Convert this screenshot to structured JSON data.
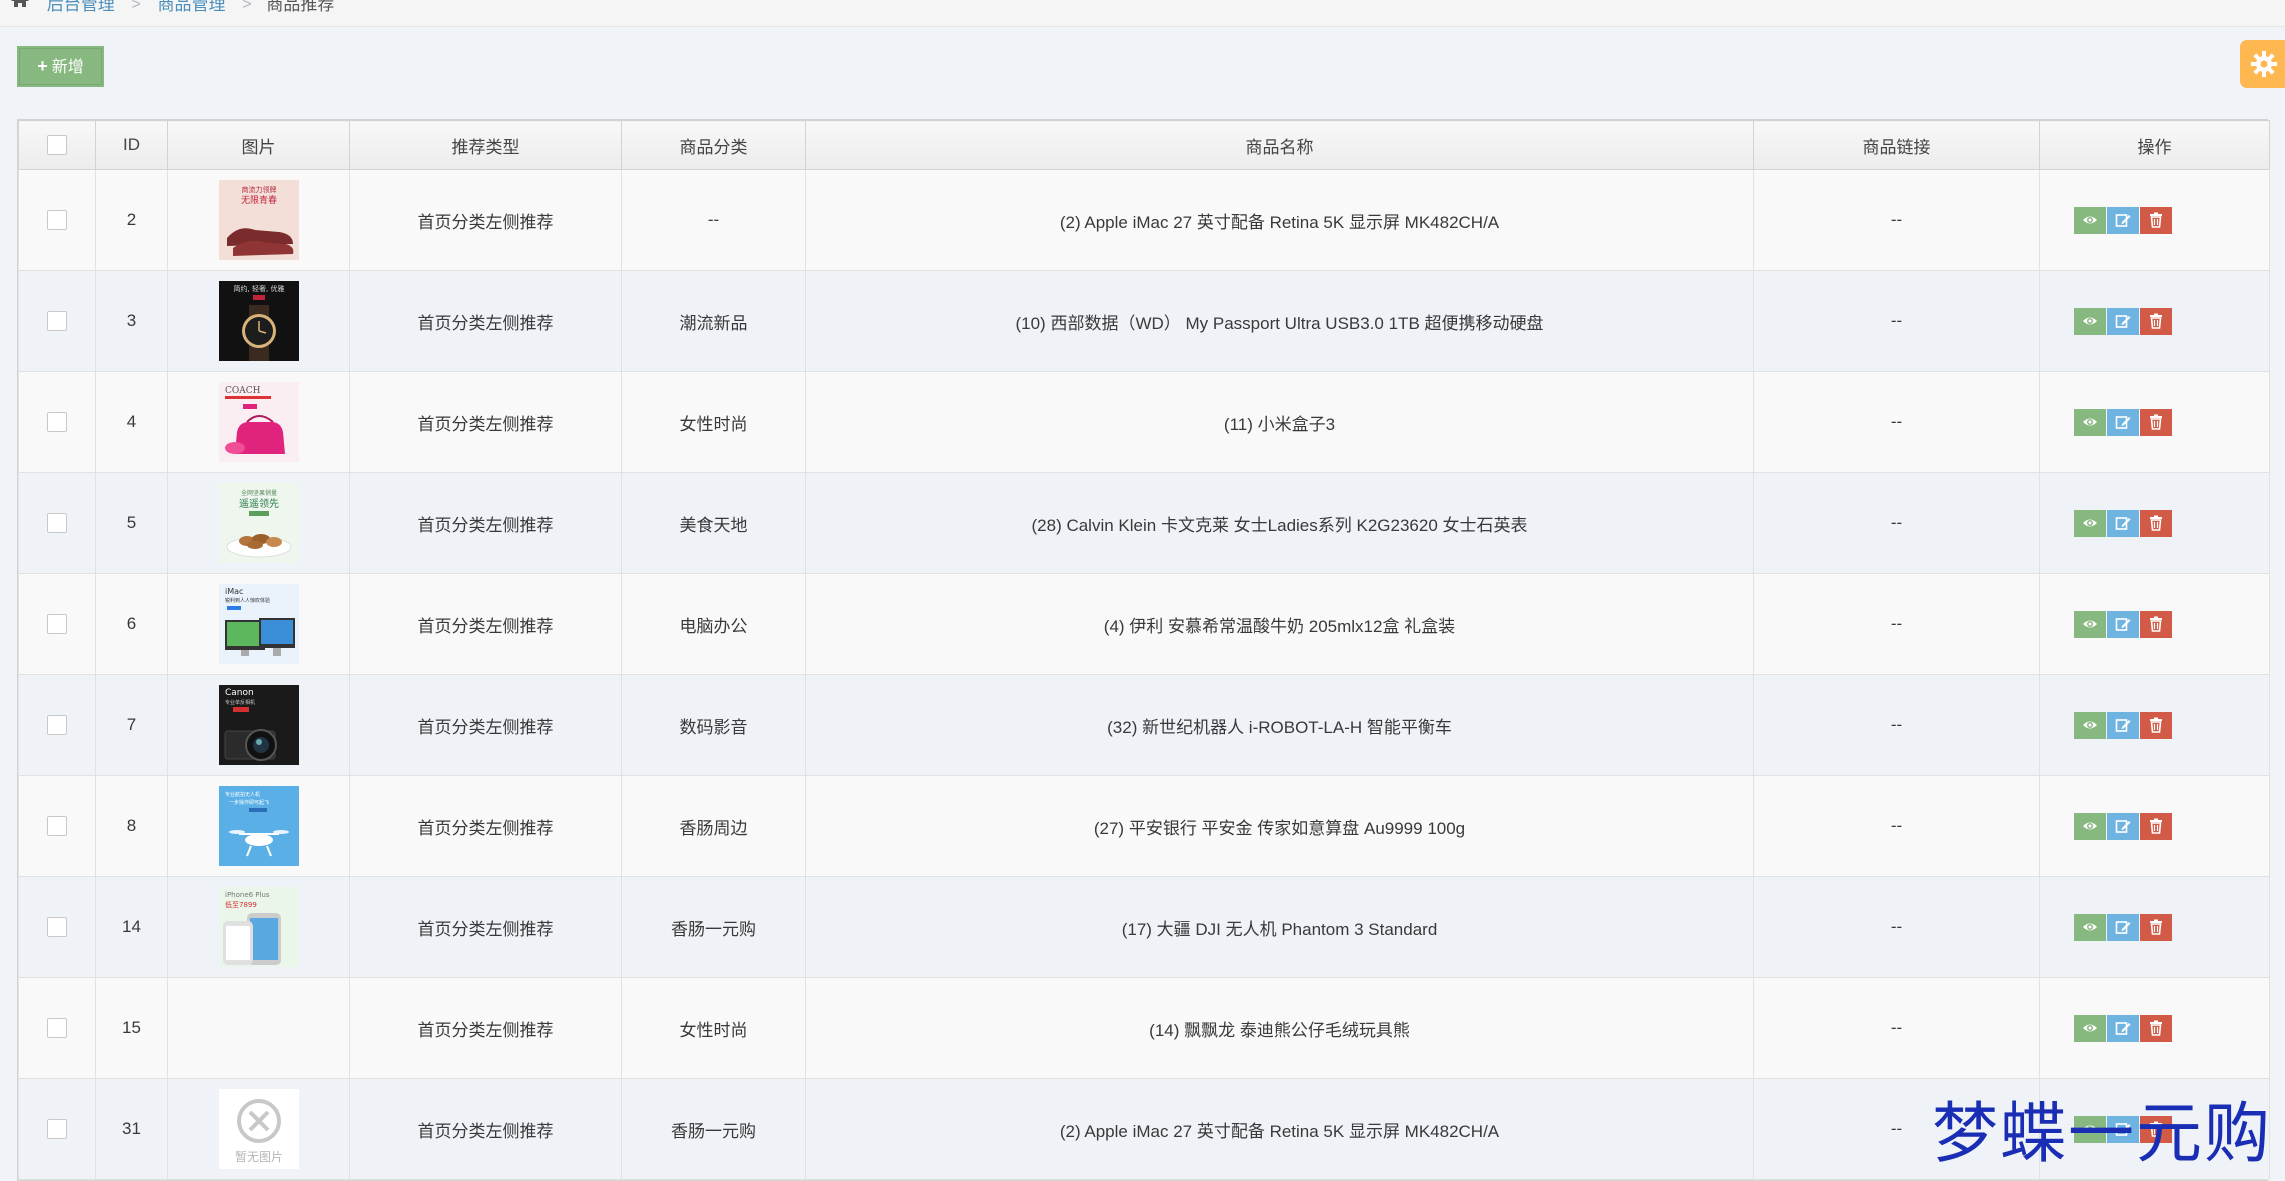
{
  "breadcrumb": {
    "items": [
      {
        "label": "后台管理"
      },
      {
        "label": "商品管理"
      }
    ],
    "current": "商品推荐",
    "separator": ">"
  },
  "toolbar": {
    "add_label": "新增",
    "add_icon": "plus-icon",
    "settings_icon": "gear-icon"
  },
  "table": {
    "columns": [
      "",
      "ID",
      "图片",
      "推荐类型",
      "商品分类",
      "商品名称",
      "商品链接",
      "操作"
    ],
    "rows": [
      {
        "id": "2",
        "type": "首页分类左侧推荐",
        "category": "--",
        "name": "(2) Apple iMac 27 英寸配备 Retina 5K 显示屏 MK482CH/A",
        "link": "--",
        "image": "shoes",
        "image_text": "商流力领牌|无限青春"
      },
      {
        "id": "3",
        "type": "首页分类左侧推荐",
        "category": "潮流新品",
        "name": "(10) 西部数据（WD） My Passport Ultra USB3.0 1TB 超便携移动硬盘",
        "link": "--",
        "image": "watch",
        "image_text": "简约, 轻奢, 优雅"
      },
      {
        "id": "4",
        "type": "首页分类左侧推荐",
        "category": "女性时尚",
        "name": "(11) 小米盒子3",
        "link": "--",
        "image": "coach",
        "image_text": "COACH"
      },
      {
        "id": "5",
        "type": "首页分类左侧推荐",
        "category": "美食天地",
        "name": "(28) Calvin Klein 卡文克莱 女士Ladies系列 K2G23620 女士石英表",
        "link": "--",
        "image": "nuts",
        "image_text": "遥遥领先"
      },
      {
        "id": "6",
        "type": "首页分类左侧推荐",
        "category": "电脑办公",
        "name": "(4) 伊利 安慕希常温酸牛奶 205mlx12盒 礼盒装",
        "link": "--",
        "image": "imac",
        "image_text": "iMac"
      },
      {
        "id": "7",
        "type": "首页分类左侧推荐",
        "category": "数码影音",
        "name": "(32) 新世纪机器人 i-ROBOT-LA-H 智能平衡车",
        "link": "--",
        "image": "canon",
        "image_text": "Canon"
      },
      {
        "id": "8",
        "type": "首页分类左侧推荐",
        "category": "香肠周边",
        "name": "(27) 平安银行 平安金 传家如意算盘 Au9999 100g",
        "link": "--",
        "image": "drone",
        "image_text": ""
      },
      {
        "id": "14",
        "type": "首页分类左侧推荐",
        "category": "香肠一元购",
        "name": "(17) 大疆 DJI 无人机 Phantom 3 Standard",
        "link": "--",
        "image": "iphone",
        "image_text": "iPhone6 Plus|低至7899"
      },
      {
        "id": "15",
        "type": "首页分类左侧推荐",
        "category": "女性时尚",
        "name": "(14) 飘飘龙 泰迪熊公仔毛绒玩具熊",
        "link": "--",
        "image": "none",
        "image_text": ""
      },
      {
        "id": "31",
        "type": "首页分类左侧推荐",
        "category": "香肠一元购",
        "name": "(2) Apple iMac 27 英寸配备 Retina 5K 显示屏 MK482CH/A",
        "link": "--",
        "image": "placeholder",
        "image_text": "暂无图片"
      }
    ],
    "actions": [
      "eye-icon",
      "edit-icon",
      "trash-icon"
    ]
  },
  "watermark": "梦蝶一元购",
  "colors": {
    "green": "#87b87f",
    "blue": "#6fb3e0",
    "red": "#d15b47",
    "orange": "#ffb752",
    "link": "#4c8fbd"
  }
}
